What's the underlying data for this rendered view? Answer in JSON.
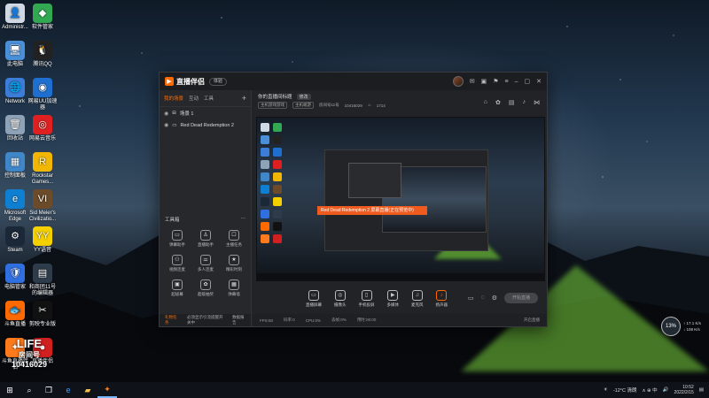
{
  "desktop": {
    "icons": [
      {
        "label": "Administr...",
        "color": "#cfd8e3",
        "glyph": "👤"
      },
      {
        "label": "软件管家",
        "color": "#33a852",
        "glyph": "◆"
      },
      {
        "label": "此电脑",
        "color": "#4a8fd8",
        "glyph": "🖥"
      },
      {
        "label": "腾讯QQ",
        "color": "#222222",
        "glyph": "🐧"
      },
      {
        "label": "Network",
        "color": "#3b7dd8",
        "glyph": "🌐"
      },
      {
        "label": "网易UU加速器",
        "color": "#1f6fd0",
        "glyph": "◉"
      },
      {
        "label": "回收站",
        "color": "#8fa3b8",
        "glyph": "🗑"
      },
      {
        "label": "网易云音乐",
        "color": "#e02020",
        "glyph": "◎"
      },
      {
        "label": "控制面板",
        "color": "#3f87c9",
        "glyph": "▦"
      },
      {
        "label": "Rockstar Games...",
        "color": "#f2b705",
        "glyph": "R"
      },
      {
        "label": "Microsoft Edge",
        "color": "#0f7fd1",
        "glyph": "e"
      },
      {
        "label": "Sid Meier's Civilizatio...",
        "color": "#6b4b2a",
        "glyph": "VI"
      },
      {
        "label": "Steam",
        "color": "#1b2838",
        "glyph": "⚙"
      },
      {
        "label": "YY语音",
        "color": "#f5d000",
        "glyph": "YY"
      },
      {
        "label": "电脑管家",
        "color": "#2f6fe0",
        "glyph": "🛡"
      },
      {
        "label": "和商团11号的编辑器",
        "color": "#2d3b4a",
        "glyph": "▤"
      },
      {
        "label": "斗鱼直播",
        "color": "#ff6a00",
        "glyph": "🐟"
      },
      {
        "label": "剪映专业版",
        "color": "#111111",
        "glyph": "✂"
      },
      {
        "label": "斗鱼直播伴侣",
        "color": "#ff7a1a",
        "glyph": "✦"
      },
      {
        "label": "直播伴侣",
        "color": "#d02020",
        "glyph": "●"
      }
    ]
  },
  "app": {
    "name": "直播伴侣",
    "version_pill": "体验",
    "scene_tabs": {
      "active": "我的场景",
      "tab2": "互动",
      "tab3": "工具",
      "add": "+"
    },
    "scenes": [
      {
        "label": "场景 1"
      },
      {
        "label": "Red Dead Redemption 2"
      }
    ],
    "tools_title": "工具箱",
    "tools_more": "⋯",
    "tools": [
      {
        "label": "弹幕助手",
        "glyph": "▭"
      },
      {
        "label": "直播助手",
        "glyph": "♙"
      },
      {
        "label": "主播任务",
        "glyph": "☐"
      },
      {
        "label": "视频连麦",
        "glyph": "⚇"
      },
      {
        "label": "多人连麦",
        "glyph": "⚌"
      },
      {
        "label": "精彩时刻",
        "glyph": "★"
      },
      {
        "label": "超级幕",
        "glyph": "▣"
      },
      {
        "label": "超级抽奖",
        "glyph": "✿"
      },
      {
        "label": "弹幕墙",
        "glyph": "▦"
      }
    ],
    "bottom_left": {
      "warn": "礼物任务",
      "text1": "必须显示引流提醒开关中",
      "text2": "数据报告"
    },
    "stream_title": "你的直播间标题",
    "edit_label": "修改",
    "meta": {
      "tag1": "主机游戏游戏",
      "tag2": "主机端游",
      "room_label": "房间号11号",
      "room_no": "10416029",
      "fans": "1714"
    },
    "preview_toast": "Red Dead Redemption 2 屏幕直播(正在预览中)",
    "controls": [
      {
        "label": "直播屏幕",
        "glyph": "▭"
      },
      {
        "label": "摄像头",
        "glyph": "◎"
      },
      {
        "label": "手机投屏",
        "glyph": "▯"
      },
      {
        "label": "多媒体",
        "glyph": "▶"
      },
      {
        "label": "麦克风",
        "glyph": "♫"
      },
      {
        "label": "扬声器",
        "glyph": "♪"
      }
    ],
    "start_live": "开始直播",
    "status": {
      "s1": "FPS:60",
      "s2": "码率:0",
      "s3": "CPU:0%",
      "s4": "丢帧:0%",
      "s5": "用时:00:00",
      "end": "开启直播"
    }
  },
  "net_widget": {
    "value": "13",
    "unit": "%",
    "up": "↑ 17.1 K/s",
    "down": "↓ 108 K/s"
  },
  "room_badge": {
    "logo": "LIFE",
    "label": "房间号",
    "number": "10416029"
  },
  "taskbar": {
    "weather": "-12°C 清朗",
    "tray_text": "∧ ⊕ 中",
    "time": "10:52",
    "date": "2022/2/15"
  }
}
